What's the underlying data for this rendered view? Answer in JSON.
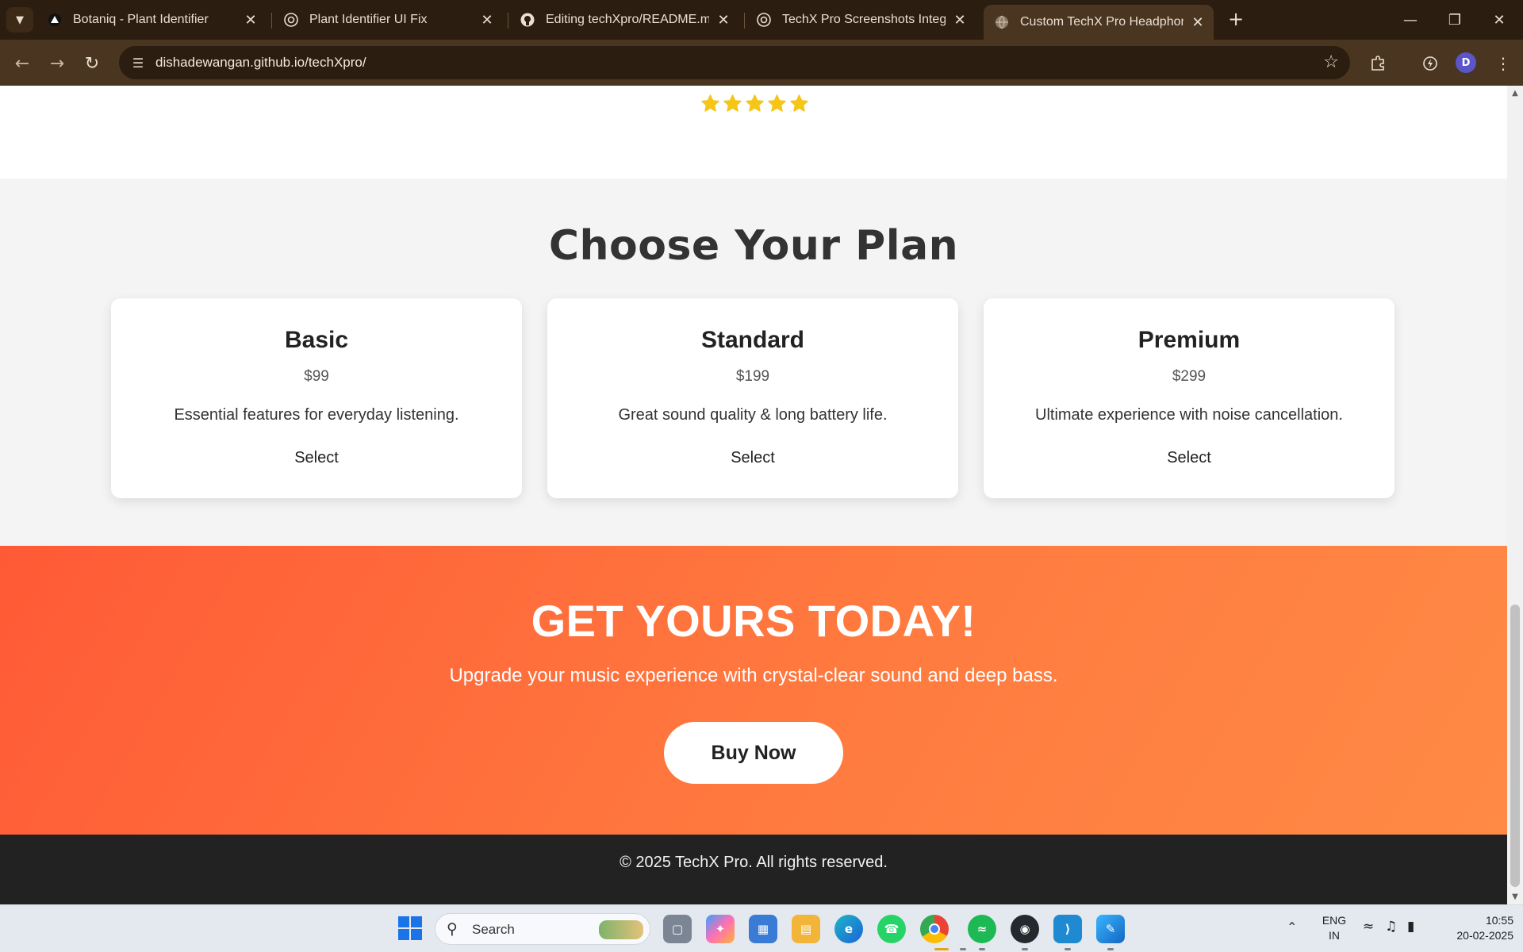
{
  "browser": {
    "tabs": [
      {
        "title": "Botaniq - Plant Identifier",
        "icon": "triangle-logo-icon",
        "active": false
      },
      {
        "title": "Plant Identifier UI Fix",
        "icon": "openai-icon",
        "active": false
      },
      {
        "title": "Editing techXpro/README.md at",
        "icon": "github-icon",
        "active": false
      },
      {
        "title": "TechX Pro Screenshots Integrati",
        "icon": "openai-icon",
        "active": false
      },
      {
        "title": "Custom TechX Pro Headphones",
        "icon": "globe-icon",
        "active": true
      }
    ],
    "url": "dishadewangan.github.io/techXpro/",
    "profile_initial": "D"
  },
  "page": {
    "rating_stars": 5,
    "plans_title": "Choose Your Plan",
    "plans": [
      {
        "name": "Basic",
        "price": "$99",
        "description": "Essential features for everyday listening.",
        "action": "Select"
      },
      {
        "name": "Standard",
        "price": "$199",
        "description": "Great sound quality & long battery life.",
        "action": "Select"
      },
      {
        "name": "Premium",
        "price": "$299",
        "description": "Ultimate experience with noise cancellation.",
        "action": "Select"
      }
    ],
    "cta": {
      "title": "GET YOURS TODAY!",
      "text": "Upgrade your music experience with crystal-clear sound and deep bass.",
      "button": "Buy Now"
    },
    "footer": "© 2025 TechX Pro. All rights reserved."
  },
  "colors": {
    "star": "#f5c518",
    "cta_start": "#ff5a36",
    "cta_end": "#ff8a45",
    "footer_bg": "#222222",
    "chrome_bg": "#2b1d0f"
  },
  "taskbar": {
    "search_label": "Search",
    "apps": [
      "task-view-icon",
      "copilot-icon",
      "microsoft-store-icon",
      "file-explorer-icon",
      "edge-icon",
      "whatsapp-icon",
      "chrome-icon",
      "spotify-icon",
      "github-desktop-icon",
      "vscode-icon",
      "paint-icon"
    ],
    "language_line1": "ENG",
    "language_line2": "IN",
    "time": "10:55",
    "date": "20-02-2025"
  }
}
